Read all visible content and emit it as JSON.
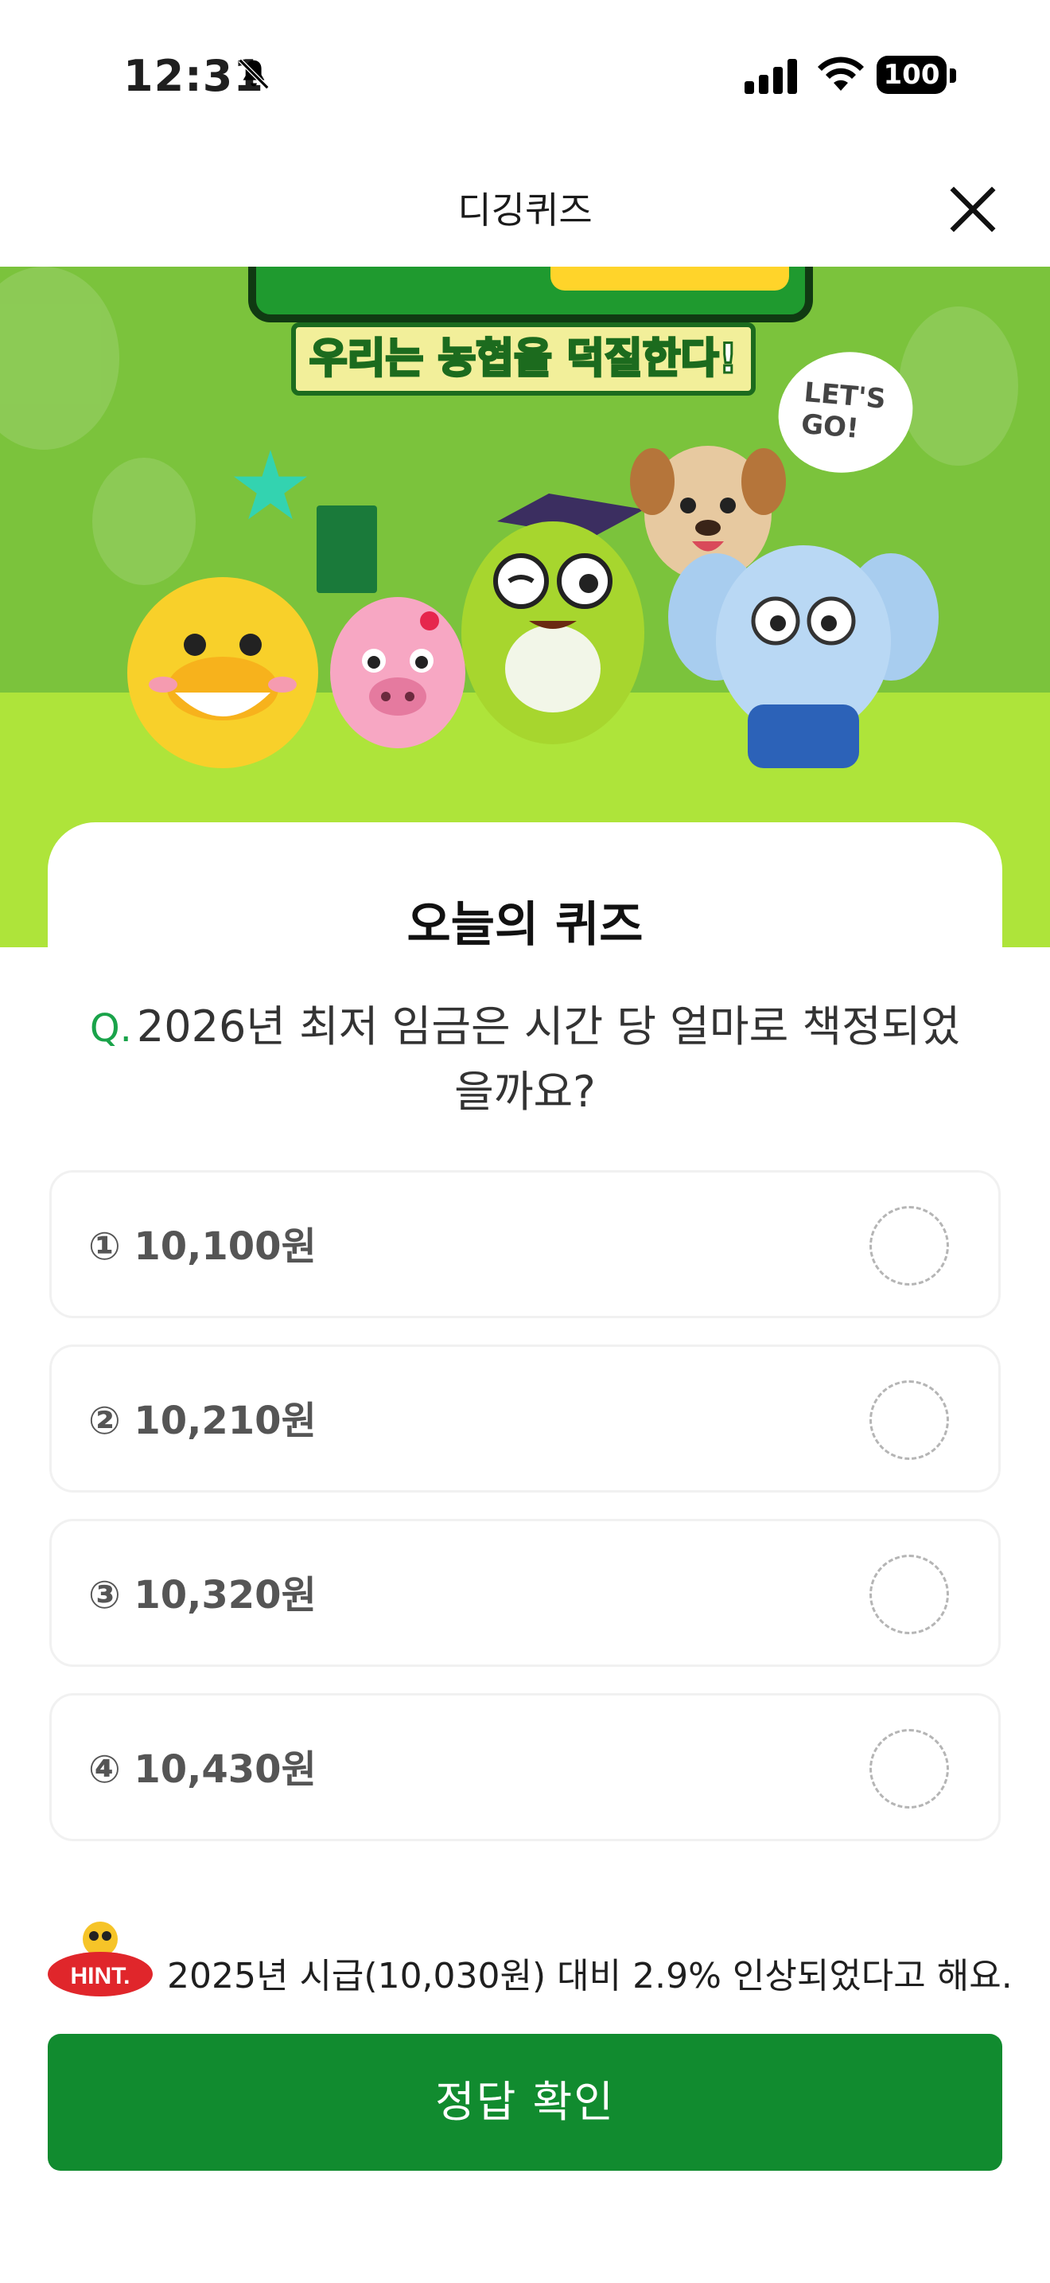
{
  "status_bar": {
    "time": "12:31",
    "battery": "100",
    "icons": [
      "bell-slash-icon",
      "signal-icon",
      "wifi-icon",
      "battery-icon"
    ]
  },
  "header": {
    "title": "디깅퀴즈",
    "close_icon": "close-icon"
  },
  "banner": {
    "tagline": "우리는 농협을 덕질한다!",
    "speech_bubble": "LET'S GO!"
  },
  "card": {
    "title": "오늘의 퀴즈"
  },
  "question": {
    "prefix": "Q.",
    "text": "2026년 최저 임금은 시간 당 얼마로 책정되었을까요?"
  },
  "options": [
    {
      "label": "① 10,100원",
      "selected": false
    },
    {
      "label": "② 10,210원",
      "selected": false
    },
    {
      "label": "③ 10,320원",
      "selected": false
    },
    {
      "label": "④ 10,430원",
      "selected": false
    }
  ],
  "hint": {
    "badge": "HINT.",
    "text": "2025년 시급(10,030원) 대비 2.9% 인상되었다고 해요."
  },
  "confirm_button": "정답 확인",
  "colors": {
    "accent_green": "#118b2f",
    "question_prefix": "#1aa34a",
    "banner_green": "#7bc33c",
    "hint_red": "#e0262b"
  }
}
